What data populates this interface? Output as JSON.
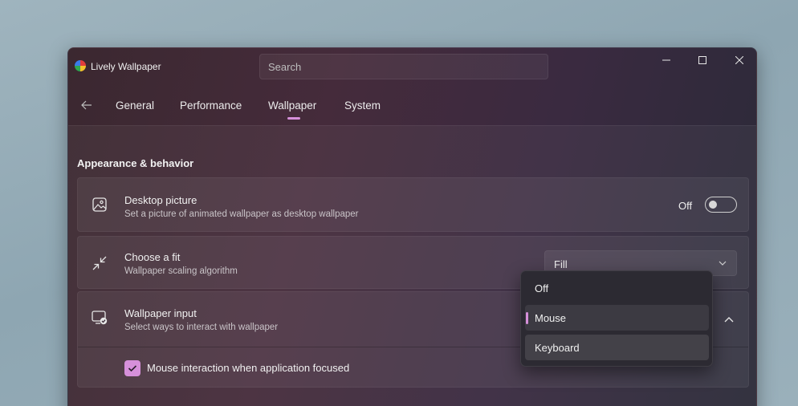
{
  "window": {
    "title": "Lively Wallpaper",
    "search_placeholder": "Search"
  },
  "nav": {
    "tabs": [
      {
        "label": "General"
      },
      {
        "label": "Performance"
      },
      {
        "label": "Wallpaper",
        "active": true
      },
      {
        "label": "System"
      }
    ]
  },
  "section": {
    "title": "Appearance & behavior"
  },
  "settings": {
    "desktop_picture": {
      "title": "Desktop picture",
      "description": "Set a picture of animated wallpaper as desktop wallpaper",
      "toggle_label": "Off",
      "enabled": false
    },
    "choose_fit": {
      "title": "Choose a fit",
      "description": "Wallpaper scaling algorithm",
      "value": "Fill"
    },
    "wallpaper_input": {
      "title": "Wallpaper input",
      "description": "Select ways to interact with wallpaper",
      "expanded": true,
      "checkbox_label": "Mouse interaction when application focused",
      "checkbox_checked": true
    }
  },
  "input_dropdown": {
    "options": [
      "Off",
      "Mouse",
      "Keyboard"
    ],
    "selected": "Mouse"
  },
  "colors": {
    "accent": "#d690da"
  }
}
